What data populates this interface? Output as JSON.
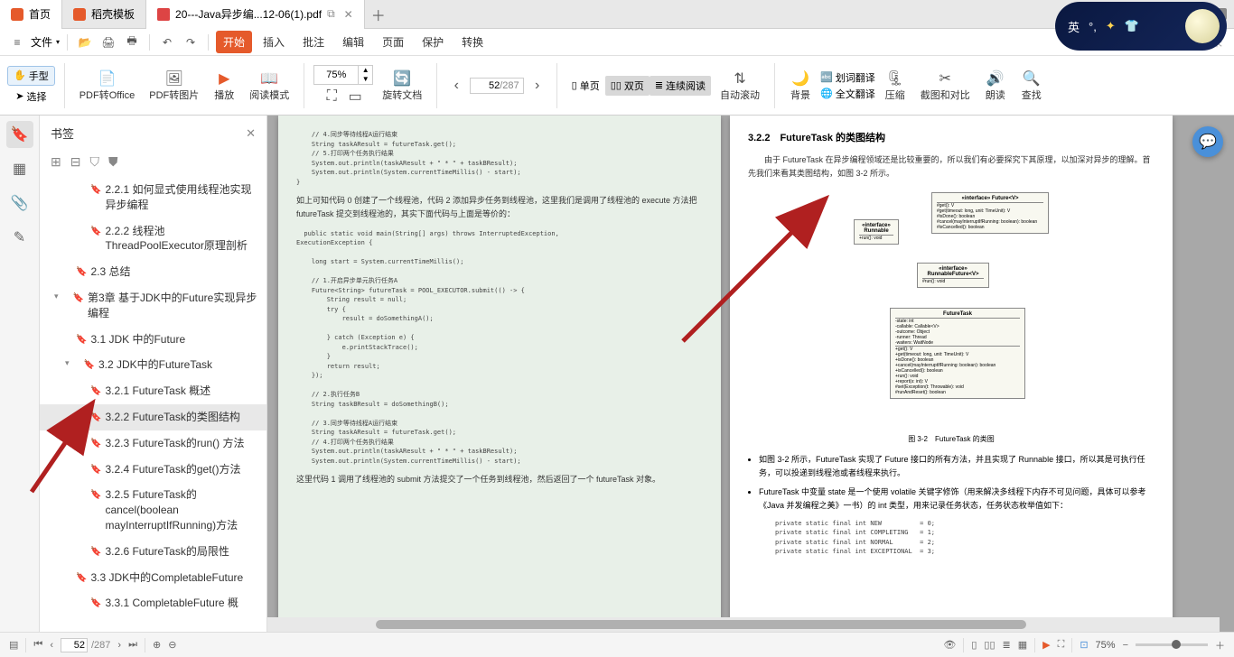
{
  "tabs": {
    "home": "首页",
    "template": "稻壳模板",
    "file": "20---Java异步编...12-06(1).pdf"
  },
  "tab_badge": "1",
  "overlay_lang": "英",
  "menu": {
    "file": "文件",
    "items": [
      "开始",
      "插入",
      "批注",
      "编辑",
      "页面",
      "保护",
      "转换"
    ]
  },
  "toolbar": {
    "hand": "手型",
    "select": "选择",
    "pdf_office": "PDF转Office",
    "pdf_image": "PDF转图片",
    "play": "播放",
    "read_mode": "阅读模式",
    "zoom": "75%",
    "rotate": "旋转文档",
    "single": "单页",
    "double": "双页",
    "continuous": "连续阅读",
    "autoscroll": "自动滚动",
    "background": "背景",
    "word_trans": "划词翻译",
    "full_trans": "全文翻译",
    "compress": "压缩",
    "screenshot": "截图和对比",
    "read_aloud": "朗读",
    "find": "查找"
  },
  "page_nav": {
    "current": "52",
    "total": "287"
  },
  "bookmarks": {
    "title": "书签",
    "items": [
      {
        "lvl": 3,
        "label": "2.2.1 如何显式使用线程池实现异步编程"
      },
      {
        "lvl": 3,
        "label": "2.2.2 线程池ThreadPoolExecutor原理剖析"
      },
      {
        "lvl": 2,
        "label": "2.3 总结"
      },
      {
        "lvl": 1,
        "label": "第3章 基于JDK中的Future实现异步编程",
        "exp": true
      },
      {
        "lvl": 2,
        "label": "3.1 JDK 中的Future"
      },
      {
        "lvl": 2,
        "label": "3.2 JDK中的FutureTask",
        "exp": true
      },
      {
        "lvl": 3,
        "label": "3.2.1 FutureTask 概述"
      },
      {
        "lvl": 3,
        "label": "3.2.2 FutureTask的类图结构",
        "sel": true
      },
      {
        "lvl": 3,
        "label": "3.2.3 FutureTask的run() 方法"
      },
      {
        "lvl": 3,
        "label": "3.2.4 FutureTask的get()方法"
      },
      {
        "lvl": 3,
        "label": "3.2.5 FutureTask的cancel(boolean mayInterruptIfRunning)方法"
      },
      {
        "lvl": 3,
        "label": "3.2.6 FutureTask的局限性"
      },
      {
        "lvl": 2,
        "label": "3.3 JDK中的CompletableFuture"
      },
      {
        "lvl": 3,
        "label": "3.3.1 CompletableFuture 概"
      }
    ]
  },
  "doc": {
    "left_code1": "    // 4.同步等待线程A运行结束\n    String taskAResult = futureTask.get();\n    // 5.打印两个任务执行结果\n    System.out.println(taskAResult + \" * \" + taskBResult);\n    System.out.println(System.currentTimeMillis() - start);\n}",
    "left_para1": "如上可知代码 0 创建了一个线程池，代码 2 添加异步任务到线程池，这里我们是调用了线程池的 execute 方法把 futureTask 提交到线程池的，其实下面代码与上面是等价的：",
    "left_code2": "  public static void main(String[] args) throws InterruptedException,\nExecutionException {\n\n    long start = System.currentTimeMillis();\n\n    // 1.开启异步单元执行任务A\n    Future<String> futureTask = POOL_EXECUTOR.submit(() -> {\n        String result = null;\n        try {\n            result = doSomethingA();\n\n        } catch (Exception e) {\n            e.printStackTrace();\n        }\n        return result;\n    });\n\n    // 2.执行任务B\n    String taskBResult = doSomethingB();\n\n    // 3.同步等待线程A运行结束\n    String taskAResult = futureTask.get();\n    // 4.打印两个任务执行结果\n    System.out.println(taskAResult + \" * \" + taskBResult);\n    System.out.println(System.currentTimeMillis() - start);",
    "left_para2": "这里代码 1 调用了线程池的 submit 方法提交了一个任务到线程池，然后返回了一个 futureTask 对象。",
    "right_title": "3.2.2　FutureTask 的类图结构",
    "right_para1": "由于 FutureTask 在异步编程领域还是比较重要的，所以我们有必要探究下其原理，以加深对异步的理解。首先我们来看其类图结构，如图 3-2 所示。",
    "uml_caption": "图 3-2　FutureTask 的类图",
    "uml": {
      "futurev": "«interface»\nFuture<V>",
      "futurev_body": "#get(): V\n#get(timeout: long, unit: TimeUnit): V\n#isDone(): boolean\n#cancel(mayInterruptIfRunning: boolean): boolean\n#isCancelled(): boolean",
      "runnable": "«interface»\nRunnable",
      "runnable_body": "+run(): void",
      "runnablefuture": "«interface»\nRunnableFuture<V>",
      "runnablefuture_body": "#run(): void",
      "futuretask": "FutureTask",
      "futuretask_body": "-state: int\n-callable: Callable<V>\n-outcome: Object\n-runner: Thread\n-waiters: WaitNode",
      "futuretask_body2": "+get(): V\n+get(timeout: long, unit: TimeUnit): V\n+isDone(): boolean\n+cancel(mayInterruptIfRunning: boolean): boolean\n+isCancelled(): boolean\n+run(): void\n+report(s: int): V\n#set(Exception(t: Throwable): void\n#runAndReset(): boolean"
    },
    "bullets": [
      "如图 3-2 所示，FutureTask 实现了 Future 接口的所有方法，并且实现了 Runnable 接口，所以其是可执行任务，可以投递到线程池或者线程来执行。",
      "FutureTask 中变量 state 是一个使用 volatile 关键字修饰（用来解决多线程下内存不可见问题，具体可以参考《Java 并发编程之美》一书）的 int 类型，用来记录任务状态，任务状态枚举值如下："
    ],
    "right_code": "private static final int NEW          = 0;\nprivate static final int COMPLETING   = 1;\nprivate static final int NORMAL       = 2;\nprivate static final int EXCEPTIONAL  = 3;"
  },
  "status": {
    "page_current": "52",
    "page_total": "287",
    "zoom": "75%"
  }
}
